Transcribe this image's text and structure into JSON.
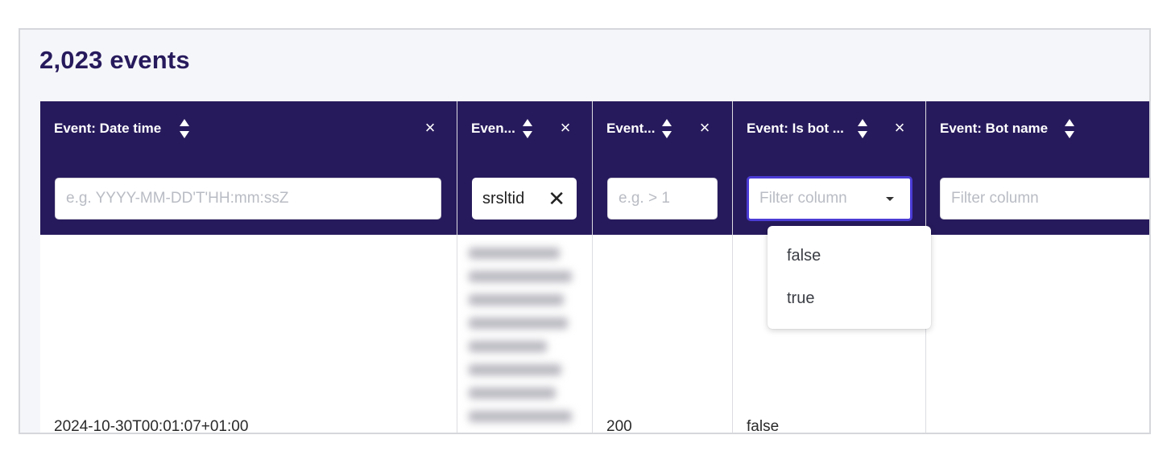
{
  "summary": {
    "count_label": "2,023 events"
  },
  "columns": [
    {
      "label": "Event: Date time",
      "filter_placeholder": "e.g. YYYY-MM-DD'T'HH:mm:ssZ",
      "cell": "2024-10-30T00:01:07+01:00"
    },
    {
      "label": "Even...",
      "filter_chip": "srsltid",
      "cell": ""
    },
    {
      "label": "Event...",
      "filter_placeholder": "e.g. > 1",
      "cell": "200"
    },
    {
      "label": "Event: Is bot ...",
      "filter_placeholder": "Filter column",
      "cell": "false"
    },
    {
      "label": "Event: Bot name",
      "filter_placeholder": "Filter column",
      "cell": ""
    }
  ],
  "dropdown": {
    "options": [
      "false",
      "true"
    ]
  },
  "icons": {
    "sort": "sort-icon",
    "close": "close-icon",
    "clear": "clear-icon",
    "caret": "caret-down-icon"
  },
  "colors": {
    "header_bg": "#271a5c",
    "accent_border": "#4b3cd6",
    "title": "#271a5c"
  }
}
